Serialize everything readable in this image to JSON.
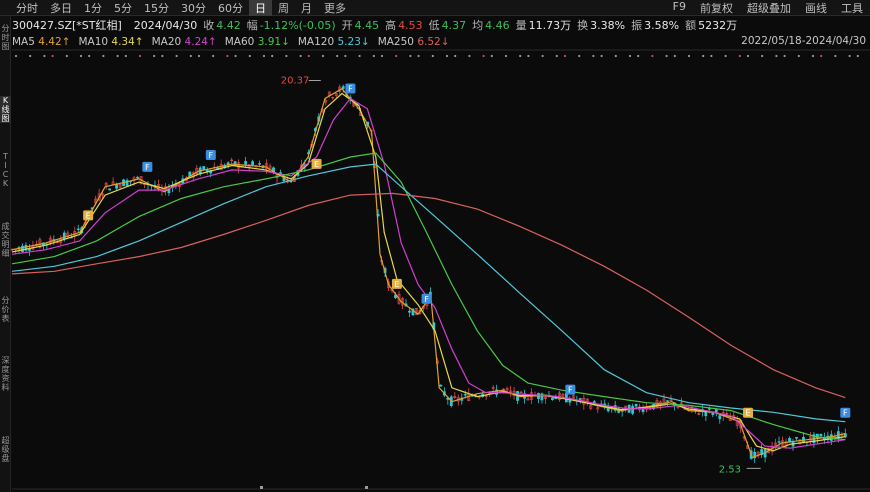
{
  "toolbar": {
    "periods": [
      {
        "label": "分时",
        "active": false
      },
      {
        "label": "多日",
        "active": false
      },
      {
        "label": "1分",
        "active": false
      },
      {
        "label": "5分",
        "active": false
      },
      {
        "label": "15分",
        "active": false
      },
      {
        "label": "30分",
        "active": false
      },
      {
        "label": "60分",
        "active": false
      },
      {
        "label": "日",
        "active": true
      },
      {
        "label": "周",
        "active": false
      },
      {
        "label": "月",
        "active": false
      },
      {
        "label": "更多",
        "active": false
      }
    ],
    "tools": [
      "F9",
      "前复权",
      "超级叠加",
      "画线",
      "工具"
    ]
  },
  "quote": {
    "code": "300427.SZ[*ST红相]",
    "date": "2024/04/30",
    "close_label": "收",
    "close": "4.42",
    "change_label": "幅",
    "change": "-1.12%(-0.05)",
    "open_label": "开",
    "open": "4.45",
    "high_label": "高",
    "high": "4.53",
    "low_label": "低",
    "low": "4.37",
    "avg_label": "均",
    "avg": "4.46",
    "volume_label": "量",
    "volume": "11.73万",
    "turnover_label": "换",
    "turnover": "3.38%",
    "amplitude_label": "振",
    "amplitude": "3.58%",
    "amount_label": "额",
    "amount": "5232万"
  },
  "ma": [
    {
      "name": "MA5",
      "value": "4.42↑",
      "color": "#e0a030"
    },
    {
      "name": "MA10",
      "value": "4.34↑",
      "color": "#e6d84a"
    },
    {
      "name": "MA20",
      "value": "4.24↑",
      "color": "#d040d0"
    },
    {
      "name": "MA60",
      "value": "3.91↓",
      "color": "#48c848"
    },
    {
      "name": "MA120",
      "value": "5.23↓",
      "color": "#50c8d8"
    },
    {
      "name": "MA250",
      "value": "6.52↓",
      "color": "#d86060"
    }
  ],
  "range_text": "2022/05/18-2024/04/30",
  "side_tabs": [
    {
      "label": "分时图",
      "active": false
    },
    {
      "label": "K线图",
      "active": true
    },
    {
      "label": "TICK",
      "active": false
    },
    {
      "label": "成交明细",
      "active": false
    },
    {
      "label": "分价表",
      "active": false
    },
    {
      "label": "深度资料",
      "active": false
    },
    {
      "label": "超级盘",
      "active": false
    }
  ],
  "colors": {
    "up": "#e04848",
    "down": "#3cbf5c",
    "candle_up": "#e84a4a",
    "candle_down": "#2cc8d8",
    "marker_f": "#3a8ee0",
    "marker_e": "#e0b040"
  },
  "chart_data": {
    "type": "line",
    "title": "",
    "date_range": [
      "2022/05/18",
      "2024/04/30"
    ],
    "y_scale": "log",
    "ylim": [
      2.3,
      23
    ],
    "annotations": [
      {
        "text": "20.37",
        "x": 0.365,
        "y": 20.37
      },
      {
        "text": "2.53",
        "x": 0.885,
        "y": 2.53
      }
    ],
    "markers": [
      {
        "kind": "E",
        "x": 0.09,
        "y": 9.4
      },
      {
        "kind": "F",
        "x": 0.16,
        "y": 12.2
      },
      {
        "kind": "F",
        "x": 0.235,
        "y": 13.0
      },
      {
        "kind": "E",
        "x": 0.36,
        "y": 12.4
      },
      {
        "kind": "F",
        "x": 0.4,
        "y": 18.6
      },
      {
        "kind": "E",
        "x": 0.455,
        "y": 6.5
      },
      {
        "kind": "F",
        "x": 0.49,
        "y": 6.0
      },
      {
        "kind": "F",
        "x": 0.66,
        "y": 3.68
      },
      {
        "kind": "E",
        "x": 0.87,
        "y": 3.25
      },
      {
        "kind": "F",
        "x": 0.985,
        "y": 3.25
      }
    ],
    "series": [
      {
        "name": "MA5",
        "color": "#e0a030",
        "points": [
          [
            0.0,
            8.2
          ],
          [
            0.04,
            8.5
          ],
          [
            0.08,
            9.0
          ],
          [
            0.11,
            11.5
          ],
          [
            0.15,
            12.0
          ],
          [
            0.18,
            11.2
          ],
          [
            0.22,
            12.5
          ],
          [
            0.26,
            13.0
          ],
          [
            0.3,
            12.8
          ],
          [
            0.33,
            11.8
          ],
          [
            0.35,
            13.5
          ],
          [
            0.37,
            18.5
          ],
          [
            0.39,
            19.5
          ],
          [
            0.41,
            17.5
          ],
          [
            0.425,
            15.5
          ],
          [
            0.435,
            8.0
          ],
          [
            0.445,
            6.8
          ],
          [
            0.46,
            6.2
          ],
          [
            0.48,
            5.8
          ],
          [
            0.495,
            6.4
          ],
          [
            0.505,
            3.9
          ],
          [
            0.52,
            3.62
          ],
          [
            0.55,
            3.78
          ],
          [
            0.58,
            3.85
          ],
          [
            0.6,
            3.72
          ],
          [
            0.63,
            3.75
          ],
          [
            0.66,
            3.68
          ],
          [
            0.69,
            3.55
          ],
          [
            0.72,
            3.45
          ],
          [
            0.75,
            3.52
          ],
          [
            0.78,
            3.62
          ],
          [
            0.8,
            3.45
          ],
          [
            0.83,
            3.42
          ],
          [
            0.86,
            3.25
          ],
          [
            0.875,
            2.68
          ],
          [
            0.89,
            2.75
          ],
          [
            0.91,
            2.9
          ],
          [
            0.94,
            2.95
          ],
          [
            0.97,
            3.0
          ],
          [
            0.985,
            3.05
          ]
        ]
      },
      {
        "name": "MA10",
        "color": "#e6d84a",
        "points": [
          [
            0.0,
            8.1
          ],
          [
            0.04,
            8.4
          ],
          [
            0.08,
            8.9
          ],
          [
            0.11,
            11.0
          ],
          [
            0.15,
            11.8
          ],
          [
            0.18,
            11.4
          ],
          [
            0.22,
            12.3
          ],
          [
            0.26,
            12.9
          ],
          [
            0.3,
            12.6
          ],
          [
            0.33,
            12.0
          ],
          [
            0.35,
            13.0
          ],
          [
            0.37,
            17.5
          ],
          [
            0.39,
            19.0
          ],
          [
            0.41,
            17.8
          ],
          [
            0.43,
            13.5
          ],
          [
            0.44,
            9.0
          ],
          [
            0.455,
            7.0
          ],
          [
            0.48,
            6.1
          ],
          [
            0.5,
            5.3
          ],
          [
            0.52,
            3.9
          ],
          [
            0.55,
            3.72
          ],
          [
            0.58,
            3.82
          ],
          [
            0.6,
            3.74
          ],
          [
            0.63,
            3.74
          ],
          [
            0.66,
            3.66
          ],
          [
            0.69,
            3.56
          ],
          [
            0.72,
            3.47
          ],
          [
            0.75,
            3.51
          ],
          [
            0.78,
            3.58
          ],
          [
            0.8,
            3.48
          ],
          [
            0.83,
            3.42
          ],
          [
            0.86,
            3.3
          ],
          [
            0.88,
            2.85
          ],
          [
            0.9,
            2.78
          ],
          [
            0.92,
            2.88
          ],
          [
            0.95,
            2.93
          ],
          [
            0.985,
            3.0
          ]
        ]
      },
      {
        "name": "MA20",
        "color": "#d040d0",
        "points": [
          [
            0.0,
            8.0
          ],
          [
            0.04,
            8.2
          ],
          [
            0.08,
            8.6
          ],
          [
            0.11,
            10.0
          ],
          [
            0.15,
            11.3
          ],
          [
            0.18,
            11.3
          ],
          [
            0.22,
            12.0
          ],
          [
            0.26,
            12.6
          ],
          [
            0.3,
            12.5
          ],
          [
            0.33,
            12.2
          ],
          [
            0.36,
            13.5
          ],
          [
            0.38,
            16.5
          ],
          [
            0.4,
            18.5
          ],
          [
            0.42,
            17.5
          ],
          [
            0.44,
            13.0
          ],
          [
            0.46,
            8.5
          ],
          [
            0.48,
            6.8
          ],
          [
            0.5,
            6.0
          ],
          [
            0.52,
            4.8
          ],
          [
            0.54,
            4.0
          ],
          [
            0.56,
            3.8
          ],
          [
            0.58,
            3.8
          ],
          [
            0.61,
            3.76
          ],
          [
            0.64,
            3.73
          ],
          [
            0.67,
            3.65
          ],
          [
            0.7,
            3.55
          ],
          [
            0.73,
            3.48
          ],
          [
            0.76,
            3.5
          ],
          [
            0.79,
            3.55
          ],
          [
            0.82,
            3.45
          ],
          [
            0.85,
            3.35
          ],
          [
            0.87,
            3.1
          ],
          [
            0.89,
            2.85
          ],
          [
            0.92,
            2.82
          ],
          [
            0.95,
            2.88
          ],
          [
            0.985,
            2.95
          ]
        ]
      },
      {
        "name": "MA60",
        "color": "#48c848",
        "points": [
          [
            0.0,
            7.6
          ],
          [
            0.05,
            7.9
          ],
          [
            0.1,
            8.6
          ],
          [
            0.15,
            9.8
          ],
          [
            0.2,
            10.8
          ],
          [
            0.25,
            11.5
          ],
          [
            0.3,
            12.0
          ],
          [
            0.35,
            12.6
          ],
          [
            0.4,
            13.5
          ],
          [
            0.43,
            13.8
          ],
          [
            0.46,
            11.8
          ],
          [
            0.49,
            9.0
          ],
          [
            0.52,
            6.8
          ],
          [
            0.55,
            5.3
          ],
          [
            0.58,
            4.4
          ],
          [
            0.61,
            4.0
          ],
          [
            0.65,
            3.85
          ],
          [
            0.7,
            3.72
          ],
          [
            0.75,
            3.6
          ],
          [
            0.8,
            3.55
          ],
          [
            0.85,
            3.45
          ],
          [
            0.9,
            3.2
          ],
          [
            0.95,
            3.0
          ],
          [
            0.985,
            2.95
          ]
        ]
      },
      {
        "name": "MA120",
        "color": "#50c8d8",
        "points": [
          [
            0.0,
            7.3
          ],
          [
            0.05,
            7.5
          ],
          [
            0.1,
            7.9
          ],
          [
            0.15,
            8.6
          ],
          [
            0.2,
            9.5
          ],
          [
            0.25,
            10.5
          ],
          [
            0.3,
            11.5
          ],
          [
            0.35,
            12.2
          ],
          [
            0.4,
            12.8
          ],
          [
            0.43,
            13.0
          ],
          [
            0.46,
            11.5
          ],
          [
            0.5,
            9.8
          ],
          [
            0.55,
            8.0
          ],
          [
            0.6,
            6.5
          ],
          [
            0.65,
            5.3
          ],
          [
            0.7,
            4.3
          ],
          [
            0.75,
            3.8
          ],
          [
            0.8,
            3.6
          ],
          [
            0.85,
            3.5
          ],
          [
            0.9,
            3.42
          ],
          [
            0.95,
            3.3
          ],
          [
            0.985,
            3.25
          ]
        ]
      },
      {
        "name": "MA250",
        "color": "#d86060",
        "points": [
          [
            0.0,
            7.2
          ],
          [
            0.05,
            7.3
          ],
          [
            0.1,
            7.6
          ],
          [
            0.15,
            7.9
          ],
          [
            0.2,
            8.3
          ],
          [
            0.25,
            8.9
          ],
          [
            0.3,
            9.6
          ],
          [
            0.35,
            10.4
          ],
          [
            0.4,
            11.0
          ],
          [
            0.45,
            11.1
          ],
          [
            0.5,
            10.8
          ],
          [
            0.55,
            10.2
          ],
          [
            0.6,
            9.3
          ],
          [
            0.65,
            8.4
          ],
          [
            0.7,
            7.5
          ],
          [
            0.75,
            6.6
          ],
          [
            0.8,
            5.7
          ],
          [
            0.85,
            4.9
          ],
          [
            0.9,
            4.3
          ],
          [
            0.95,
            3.9
          ],
          [
            0.985,
            3.7
          ]
        ]
      }
    ]
  }
}
